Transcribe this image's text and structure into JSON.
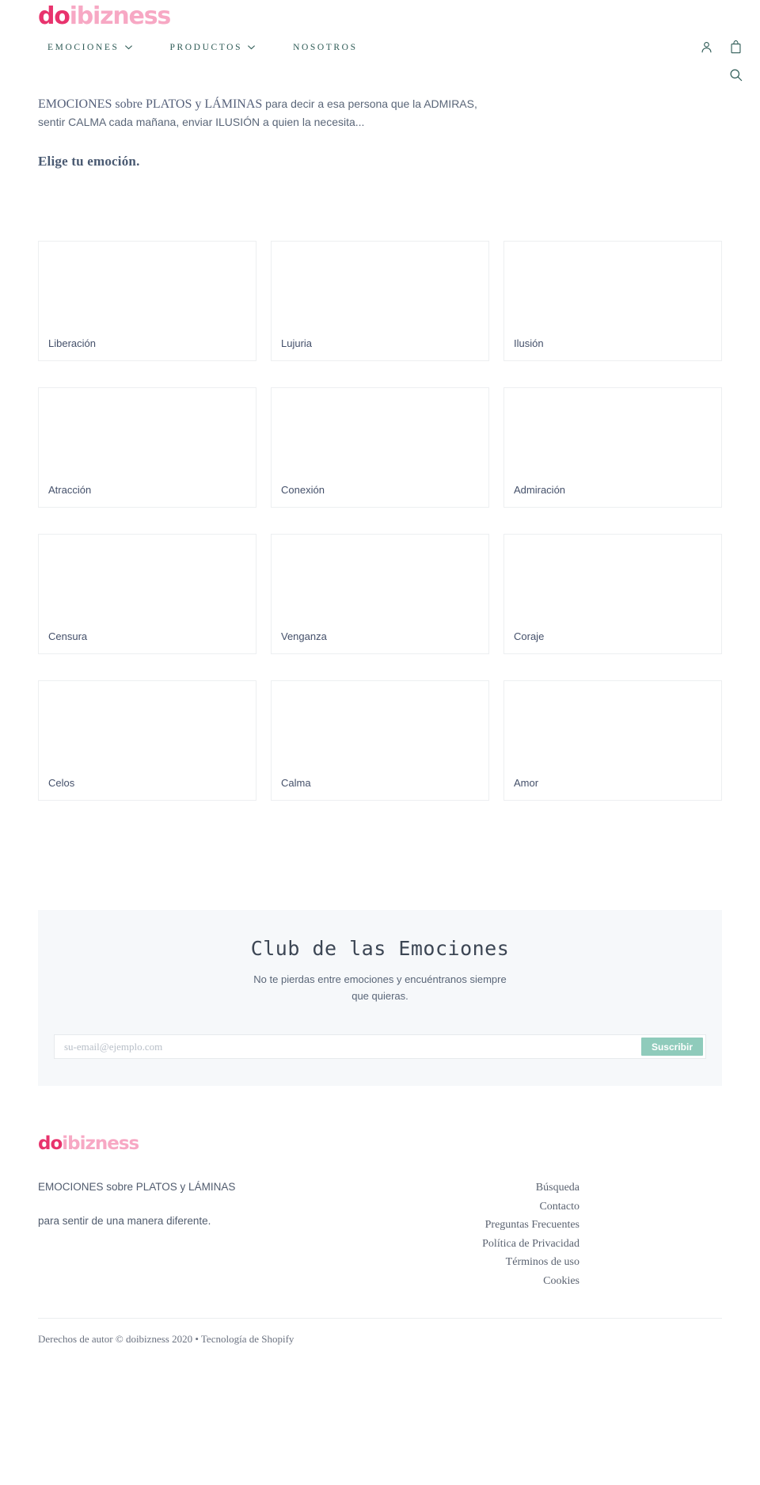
{
  "brand": {
    "logo_prefix": "do",
    "logo_suffix": "ibizness",
    "accent_pink": "#e8336d",
    "accent_pink_light": "#f7a8c4",
    "accent_teal": "#2d5a55",
    "button_green": "#8fcbbb"
  },
  "nav": {
    "items": [
      {
        "label": "EMOCIONES",
        "has_caret": true
      },
      {
        "label": "PRODUCTOS",
        "has_caret": true
      },
      {
        "label": "NOSOTROS",
        "has_caret": false
      }
    ]
  },
  "header_icons": [
    {
      "name": "account-icon",
      "label": "Cuenta"
    },
    {
      "name": "bag-icon",
      "label": "Carrito"
    },
    {
      "name": "search-icon",
      "label": "Buscar"
    }
  ],
  "intro": {
    "lead_serif": "EMOCIONES sobre PLATOS y LÁMINAS",
    "lead_rest": " para decir a esa persona que la ADMIRAS, sentir CALMA cada mañana, enviar ILUSIÓN a quien la necesita...",
    "heading": "Elige tu emoción."
  },
  "grid": {
    "cards": [
      {
        "label": "Liberación"
      },
      {
        "label": "Lujuria"
      },
      {
        "label": "Ilusión"
      },
      {
        "label": "Atracción"
      },
      {
        "label": "Conexión"
      },
      {
        "label": "Admiración"
      },
      {
        "label": "Censura"
      },
      {
        "label": "Venganza"
      },
      {
        "label": "Coraje"
      },
      {
        "label": "Celos"
      },
      {
        "label": "Calma"
      },
      {
        "label": "Amor"
      }
    ]
  },
  "newsletter": {
    "title": "Club de las Emociones",
    "subtitle": "No te pierdas entre emociones y encuéntranos siempre que quieras.",
    "email_placeholder": "su-email@ejemplo.com",
    "email_value": "",
    "submit_label": "Suscribir"
  },
  "footer": {
    "about_line1": "EMOCIONES sobre PLATOS y LÁMINAS",
    "about_line2": "para sentir de una manera diferente.",
    "links": [
      {
        "label": "Búsqueda"
      },
      {
        "label": "Contacto"
      },
      {
        "label": "Preguntas Frecuentes"
      },
      {
        "label": "Política de Privacidad"
      },
      {
        "label": "Términos de uso"
      },
      {
        "label": "Cookies"
      }
    ],
    "copyright": "Derechos de autor © doibizness 2020 • Tecnología de Shopify"
  }
}
